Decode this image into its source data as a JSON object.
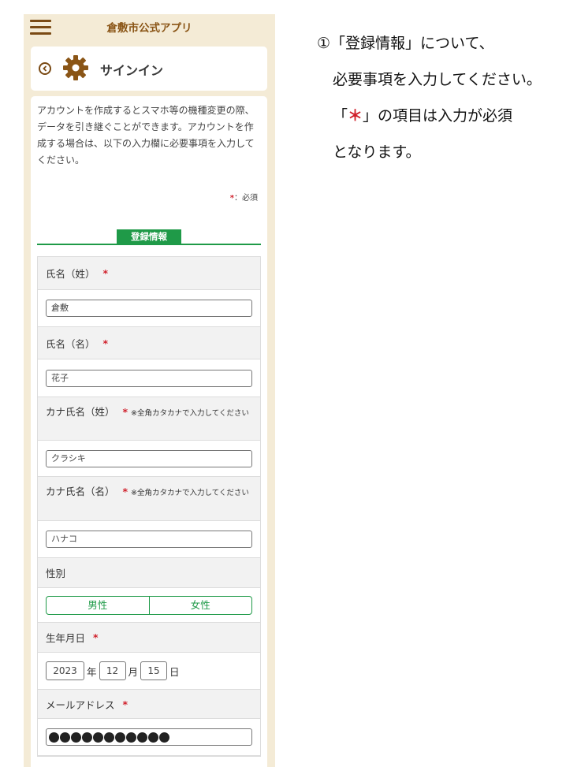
{
  "app": {
    "title": "倉敷市公式アプリ"
  },
  "header": {
    "title": "サインイン"
  },
  "intro": {
    "text": "アカウントを作成するとスマホ等の機種変更の際、データを引き継ぐことができます。アカウントを作成する場合は、以下の入力欄に必要事項を入力してください。"
  },
  "required_note": {
    "star": "*",
    "text": "：必須"
  },
  "section": {
    "label": "登録情報"
  },
  "form": {
    "last_name": {
      "label": "氏名（姓）",
      "value": "倉敷"
    },
    "first_name": {
      "label": "氏名（名）",
      "value": "花子"
    },
    "kana_last": {
      "label": "カナ氏名（姓）",
      "note": "※全角カタカナで入力してください",
      "value": "クラシキ"
    },
    "kana_first": {
      "label": "カナ氏名（名）",
      "note": "※全角カタカナで入力してください",
      "value": "ハナコ"
    },
    "gender": {
      "label": "性別",
      "options": [
        "男性",
        "女性"
      ]
    },
    "birthday": {
      "label": "生年月日",
      "year": "2023",
      "year_unit": "年",
      "month": "12",
      "month_unit": "月",
      "day": "15",
      "day_unit": "日"
    },
    "email": {
      "label": "メールアドレス",
      "masked_length": 11
    },
    "required_star": "*"
  },
  "annotation": {
    "line1": "①「登録情報」について、",
    "line2": "必要事項を入力してください。",
    "line3_open": "「",
    "line3_star": "＊",
    "line3_rest": "」の項目は入力が必須",
    "line4": "となります。"
  },
  "colors": {
    "brand_brown": "#7a4a14",
    "accent_green": "#1f9a48",
    "required_red": "#d01f2a",
    "frame_beige": "#f4ebd6"
  },
  "icons": {
    "menu": "hamburger-icon",
    "back": "back-circle-icon",
    "settings": "gear-icon"
  }
}
